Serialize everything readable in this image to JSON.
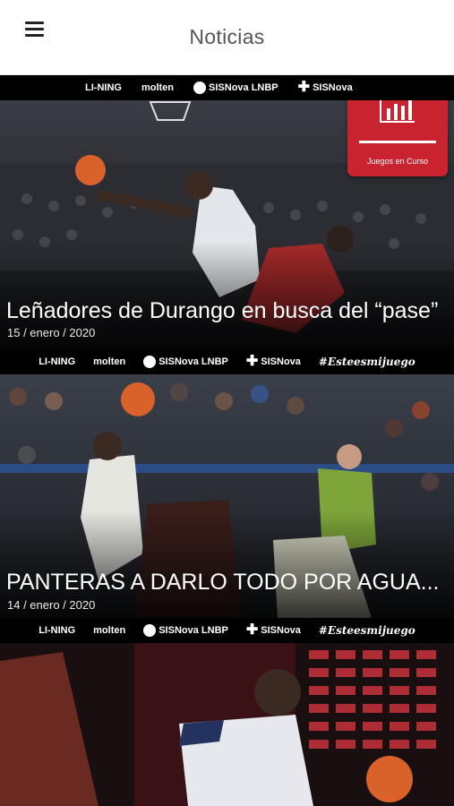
{
  "header": {
    "title": "Noticias",
    "menu_icon": "hamburger-menu-icon"
  },
  "sponsors_row": [
    "LI-NING",
    "molten",
    "SISNova LNBP",
    "SISNova"
  ],
  "sponsors_row_full": [
    "LI-NING",
    "molten",
    "SISNova LNBP",
    "SISNova",
    "#Esteesmijuego"
  ],
  "live_games": {
    "label": "Juegos en Curso",
    "icon": "bar-chart-icon",
    "color": "#c8232f"
  },
  "news": [
    {
      "headline": "Leñadores de Durango en busca del “pase”",
      "date": "15 / enero / 2020"
    },
    {
      "headline": "PANTERAS A DARLO TODO POR AGUA...",
      "date": "14 / enero / 2020"
    },
    {
      "headline": "",
      "date": ""
    }
  ]
}
